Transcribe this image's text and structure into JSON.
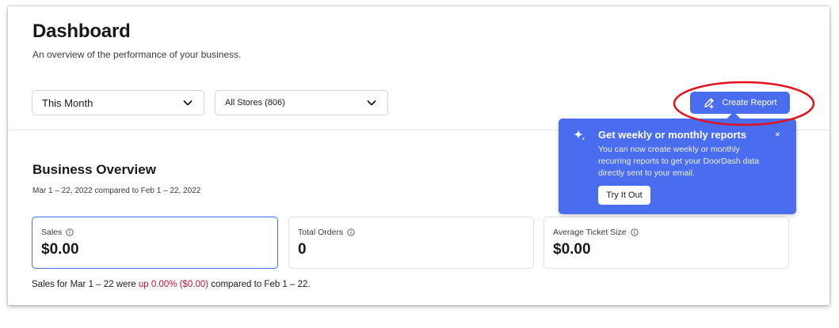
{
  "header": {
    "title": "Dashboard",
    "subtitle": "An overview of the performance of your business."
  },
  "filters": {
    "period": {
      "value": "This Month",
      "icon": "chevron-down-icon"
    },
    "stores": {
      "value": "All Stores (806)",
      "icon": "chevron-down-icon"
    }
  },
  "actions": {
    "create_report_label": "Create Report",
    "create_report_icon": "edit-chart-icon"
  },
  "tooltip": {
    "icon": "sparkle-icon",
    "title": "Get weekly or monthly reports",
    "body": "You can now create weekly or monthly recurring reports to get your DoorDash data directly sent to your email.",
    "close": "×",
    "button": "Try It Out"
  },
  "overview": {
    "title": "Business Overview",
    "date_range": "Mar 1 – 22, 2022 compared to Feb 1 – 22, 2022",
    "cards": [
      {
        "label": "Sales",
        "value": "$0.00",
        "icon": "info-icon"
      },
      {
        "label": "Total Orders",
        "value": "0",
        "icon": "info-icon"
      },
      {
        "label": "Average Ticket Size",
        "value": "$0.00",
        "icon": "info-icon"
      }
    ],
    "summary": {
      "prefix": "Sales for Mar 1 – 22 were ",
      "change": "up 0.00% ($0.00)",
      "suffix": " compared to Feb 1 – 22."
    }
  },
  "colors": {
    "accent": "#4a6df0",
    "annotation": "#e3101a",
    "change_up": "#c8102e",
    "text": "#191919"
  }
}
